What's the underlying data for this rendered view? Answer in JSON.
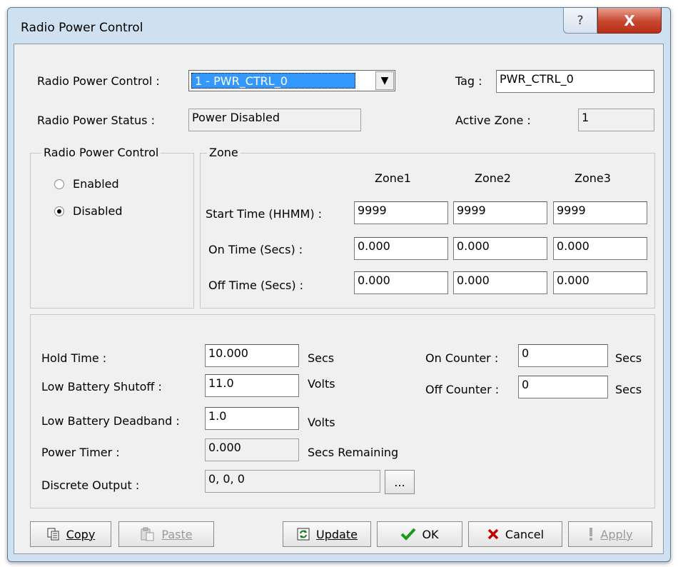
{
  "window": {
    "title": "Radio Power Control",
    "help_glyph": "?",
    "close_glyph": "X"
  },
  "top": {
    "control_label": "Radio Power Control :",
    "control_value": "1 - PWR_CTRL_0",
    "tag_label": "Tag :",
    "tag_value": "PWR_CTRL_0",
    "status_label": "Radio Power Status :",
    "status_value": "Power Disabled",
    "active_zone_label": "Active Zone :",
    "active_zone_value": "1"
  },
  "control_group": {
    "title": "Radio Power Control",
    "options": [
      {
        "label": "Enabled",
        "selected": false
      },
      {
        "label": "Disabled",
        "selected": true
      }
    ]
  },
  "zone_group": {
    "title": "Zone",
    "columns": [
      "Zone1",
      "Zone2",
      "Zone3"
    ],
    "rows": [
      {
        "label": "Start Time (HHMM) :",
        "values": [
          "9999",
          "9999",
          "9999"
        ]
      },
      {
        "label": "On Time (Secs) :",
        "values": [
          "0.000",
          "0.000",
          "0.000"
        ]
      },
      {
        "label": "Off Time (Secs) :",
        "values": [
          "0.000",
          "0.000",
          "0.000"
        ]
      }
    ]
  },
  "settings": {
    "hold_time": {
      "label": "Hold Time :",
      "value": "10.000",
      "unit": "Secs"
    },
    "low_battery_shutoff": {
      "label": "Low Battery Shutoff :",
      "value": "11.0",
      "unit": "Volts"
    },
    "low_battery_deadband": {
      "label": "Low Battery Deadband :",
      "value": "1.0",
      "unit": "Volts"
    },
    "power_timer": {
      "label": "Power Timer :",
      "value": "0.000",
      "unit": "Secs Remaining"
    },
    "discrete_output": {
      "label": "Discrete Output :",
      "value": "0, 0, 0",
      "button": "..."
    },
    "on_counter": {
      "label": "On Counter :",
      "value": "0",
      "unit": "Secs"
    },
    "off_counter": {
      "label": "Off Counter :",
      "value": "0",
      "unit": "Secs"
    }
  },
  "buttons": {
    "copy": "Copy",
    "paste": "Paste",
    "update": "Update",
    "ok": "OK",
    "cancel": "Cancel",
    "apply": "Apply"
  },
  "colors": {
    "selection": "#3399ff",
    "ok_check": "#1a9a1a",
    "cancel_x": "#c00000",
    "close_button": "#c8462f"
  }
}
